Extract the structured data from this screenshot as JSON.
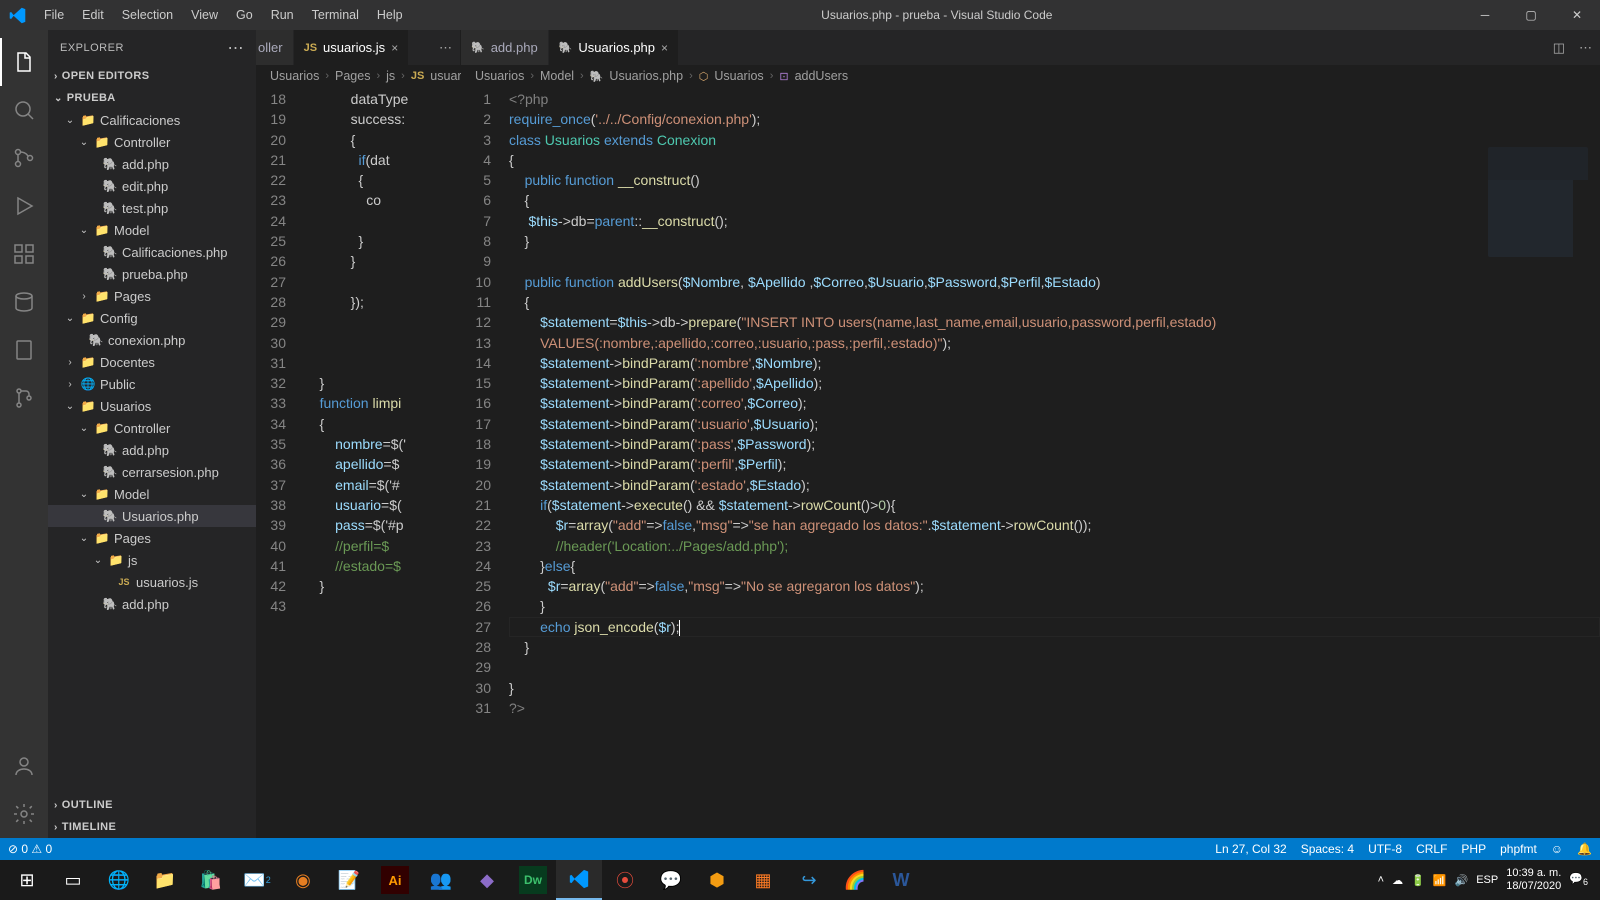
{
  "titlebar": {
    "title": "Usuarios.php - prueba - Visual Studio Code"
  },
  "menu": [
    "File",
    "Edit",
    "Selection",
    "View",
    "Go",
    "Run",
    "Terminal",
    "Help"
  ],
  "sidebar": {
    "header": "EXPLORER",
    "open_editors": "OPEN EDITORS",
    "project": "PRUEBA",
    "outline": "OUTLINE",
    "timeline": "TIMELINE",
    "tree": {
      "calificaciones": "Calificaciones",
      "controller": "Controller",
      "addphp": "add.php",
      "editphp": "edit.php",
      "testphp": "test.php",
      "model": "Model",
      "calificacionesphp": "Calificaciones.php",
      "pruebaphp": "prueba.php",
      "pages": "Pages",
      "config": "Config",
      "conexionphp": "conexion.php",
      "docentes": "Docentes",
      "public": "Public",
      "usuarios": "Usuarios",
      "controller2": "Controller",
      "addphp2": "add.php",
      "cerrarsesion": "cerrarsesion.php",
      "model2": "Model",
      "usuariosphp": "Usuarios.php",
      "pages2": "Pages",
      "js": "js",
      "usuariosjs": "usuarios.js",
      "addphp3": "add.php"
    }
  },
  "tabs": {
    "hidden": "oller",
    "usuariosjs": "usuarios.js",
    "addphp": "add.php",
    "usuariosphp": "Usuarios.php"
  },
  "breadcrumb_left": {
    "p0": "Usuarios",
    "p1": "Pages",
    "p2": "js",
    "p3": "usuario..."
  },
  "breadcrumb_right": {
    "p0": "Usuarios",
    "p1": "Model",
    "p2": "Usuarios.php",
    "p3": "Usuarios",
    "p4": "addUsers"
  },
  "left_gutter_start": 18,
  "left_gutter_end": 43,
  "right_gutter_start": 1,
  "right_gutter_end": 31,
  "left_code": {
    "l18": "dataType",
    "l19": "success:",
    "l20": "{",
    "l21": "if(dat",
    "l22": "{",
    "l23": "co",
    "l24": "",
    "l25": "}",
    "l26": "}",
    "l27": "",
    "l28": "});",
    "l29": "",
    "l30": "",
    "l31": "",
    "l32": "}",
    "l33": "function limpi",
    "l34": "{",
    "l35": "nombre=$('",
    "l36": "apellido=$",
    "l37": "email=$('#",
    "l38": "usuario=$(",
    "l39": "pass=$('#p",
    "l40": "//perfil=$",
    "l41": "//estado=$",
    "l42": "}",
    "l43": ""
  },
  "statusbar": {
    "errors": "0",
    "warnings": "0",
    "pos": "Ln 27, Col 32",
    "spaces": "Spaces: 4",
    "enc": "UTF-8",
    "eol": "CRLF",
    "lang": "PHP",
    "fmt": "phpfmt"
  },
  "tray": {
    "lang": "ESP",
    "time": "10:39 a. m.",
    "date": "18/07/2020",
    "count": "6"
  }
}
